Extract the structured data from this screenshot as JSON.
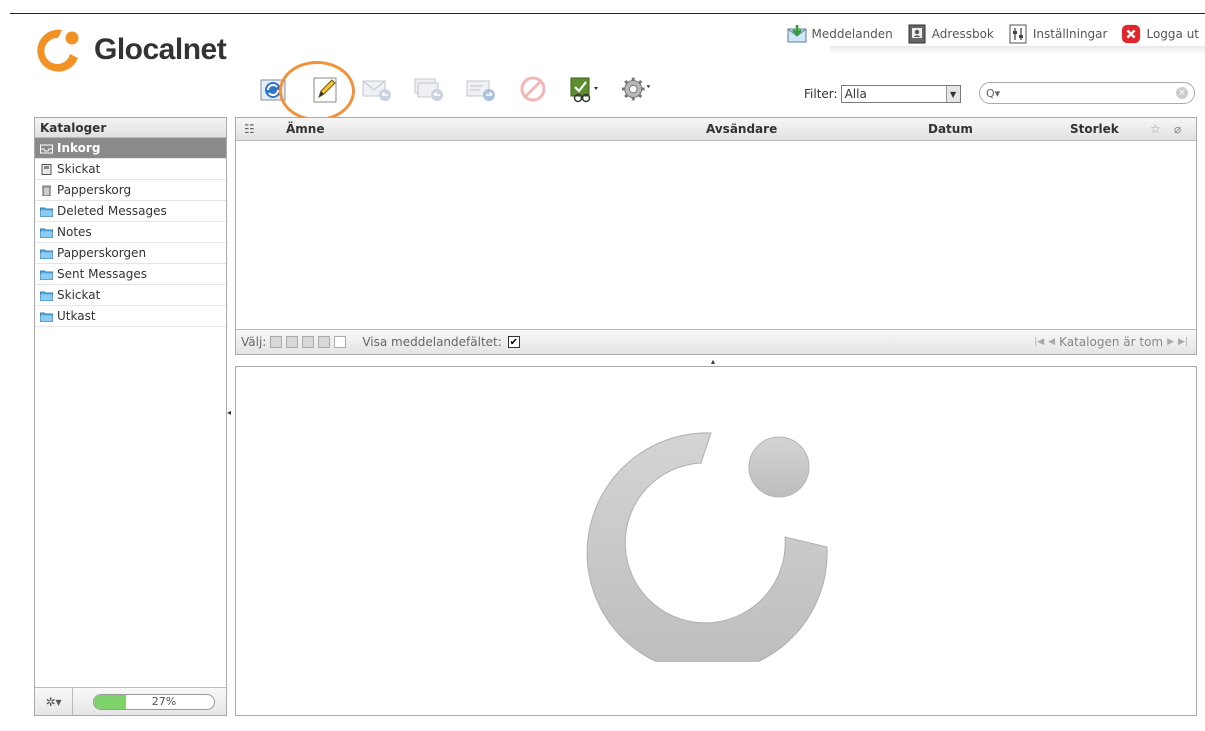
{
  "brand": {
    "name": "Glocalnet",
    "accent": "#f39224"
  },
  "topnav": {
    "messages": {
      "label": "Meddelanden",
      "icon": "mail-download-icon"
    },
    "addressbook": {
      "label": "Adressbok",
      "icon": "addressbook-icon"
    },
    "settings": {
      "label": "Inställningar",
      "icon": "settings-icon"
    },
    "logout": {
      "label": "Logga ut",
      "icon": "logout-icon"
    }
  },
  "toolbar": {
    "buttons": [
      {
        "name": "refresh",
        "icon": "refresh-icon",
        "enabled": true
      },
      {
        "name": "compose",
        "icon": "pencil-icon",
        "enabled": true,
        "highlighted": true
      },
      {
        "name": "reply",
        "icon": "reply-icon",
        "enabled": false
      },
      {
        "name": "reply-all",
        "icon": "reply-all-icon",
        "enabled": false
      },
      {
        "name": "forward",
        "icon": "forward-icon",
        "enabled": false
      },
      {
        "name": "delete",
        "icon": "delete-icon",
        "enabled": false
      },
      {
        "name": "mark",
        "icon": "mark-read-icon",
        "enabled": true
      },
      {
        "name": "more",
        "icon": "gear-icon",
        "enabled": true
      }
    ],
    "highlight_color": "#f0923a"
  },
  "filter": {
    "label": "Filter:",
    "value": "Alla"
  },
  "search": {
    "placeholder": "",
    "value": ""
  },
  "sidebar": {
    "title": "Kataloger",
    "items": [
      {
        "label": "Inkorg",
        "icon": "inbox-icon",
        "active": true
      },
      {
        "label": "Skickat",
        "icon": "sent-icon"
      },
      {
        "label": "Papperskorg",
        "icon": "trash-icon"
      },
      {
        "label": "Deleted Messages",
        "icon": "folder-icon"
      },
      {
        "label": "Notes",
        "icon": "folder-icon"
      },
      {
        "label": "Papperskorgen",
        "icon": "folder-icon"
      },
      {
        "label": "Sent Messages",
        "icon": "folder-icon"
      },
      {
        "label": "Skickat",
        "icon": "folder-icon"
      },
      {
        "label": "Utkast",
        "icon": "folder-icon"
      }
    ],
    "quota": {
      "percent": 27,
      "label": "27%"
    }
  },
  "messagelist": {
    "columns": {
      "subject": "Ämne",
      "sender": "Avsändare",
      "date": "Datum",
      "size": "Storlek"
    },
    "select_label": "Välj:",
    "preview_toggle_label": "Visa meddelandefältet:",
    "preview_toggle_checked": true,
    "status": "Katalogen är tom"
  }
}
